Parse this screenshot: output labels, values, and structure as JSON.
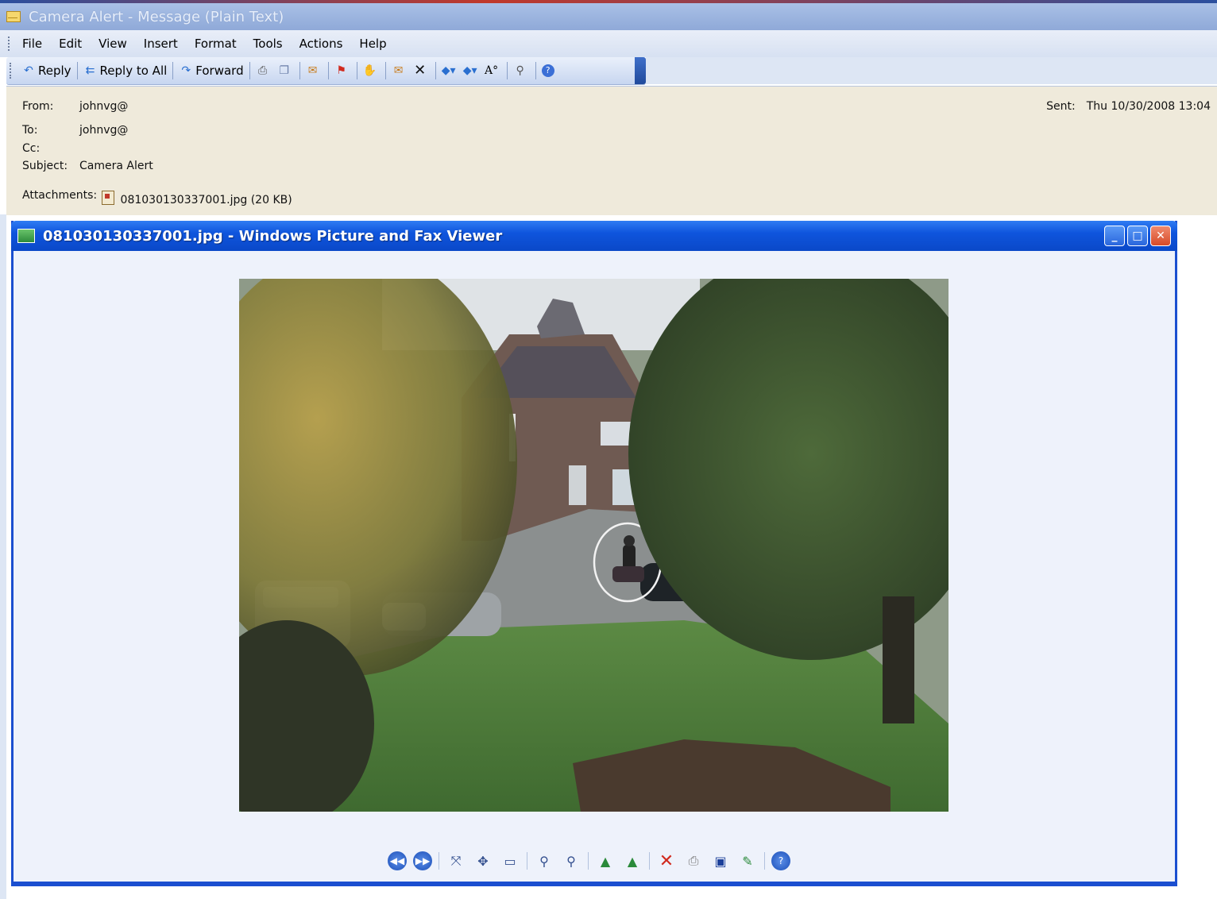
{
  "outlook": {
    "title": "Camera Alert - Message (Plain Text)",
    "menu": [
      "File",
      "Edit",
      "View",
      "Insert",
      "Format",
      "Tools",
      "Actions",
      "Help"
    ],
    "toolbar": {
      "reply": "Reply",
      "reply_all": "Reply to All",
      "forward": "Forward"
    },
    "header": {
      "from_label": "From:",
      "from_value": "johnvg@",
      "to_label": "To:",
      "to_value": "johnvg@",
      "cc_label": "Cc:",
      "cc_value": "",
      "subject_label": "Subject:",
      "subject_value": "Camera Alert",
      "sent_label": "Sent:",
      "sent_value": "Thu 10/30/2008 13:04",
      "attachments_label": "Attachments:",
      "attachment": "081030130337001.jpg (20 KB)"
    }
  },
  "viewer": {
    "title": "081030130337001.jpg - Windows Picture and Fax Viewer",
    "window_buttons": {
      "minimize": "_",
      "maximize": "□",
      "close": "✕"
    }
  },
  "icons": {
    "toolbar": [
      "reply-icon",
      "reply-all-icon",
      "forward-icon",
      "print-icon",
      "copy-icon",
      "move-icon",
      "flag-icon",
      "categorize-icon",
      "junk-icon",
      "delete-icon",
      "previous-icon",
      "next-icon",
      "font-size-icon",
      "address-book-icon",
      "help-icon"
    ],
    "viewer": [
      "previous-image-icon",
      "next-image-icon",
      "best-fit-icon",
      "actual-size-icon",
      "slideshow-icon",
      "zoom-in-icon",
      "zoom-out-icon",
      "rotate-clockwise-icon",
      "rotate-counterclockwise-icon",
      "delete-icon",
      "print-icon",
      "save-icon",
      "edit-icon",
      "help-icon"
    ]
  },
  "colors": {
    "viewer_titlebar": "#0a48c8",
    "header_background": "#efeadb",
    "outlook_titlebar": "#8fa9d8"
  }
}
